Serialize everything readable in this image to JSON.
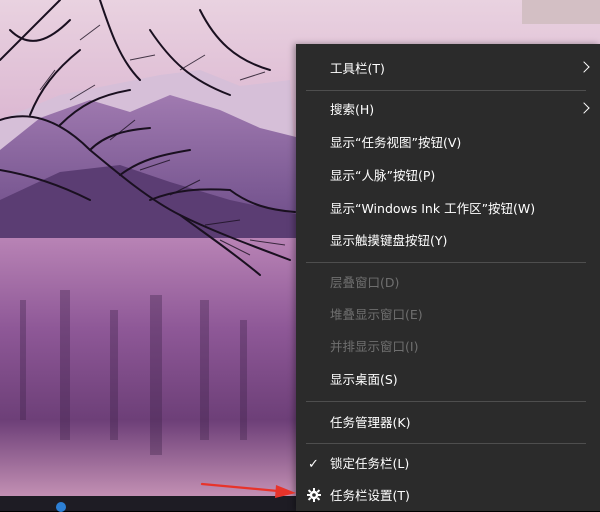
{
  "context_menu": {
    "items": [
      {
        "label": "工具栏(T)",
        "has_submenu": true,
        "enabled": true
      },
      {
        "label": "搜索(H)",
        "has_submenu": true,
        "enabled": true
      },
      {
        "label": "显示“任务视图”按钮(V)",
        "enabled": true
      },
      {
        "label": "显示“人脉”按钮(P)",
        "enabled": true
      },
      {
        "label": "显示“Windows Ink 工作区”按钮(W)",
        "enabled": true
      },
      {
        "label": "显示触摸键盘按钮(Y)",
        "enabled": true
      },
      {
        "label": "层叠窗口(D)",
        "enabled": false
      },
      {
        "label": "堆叠显示窗口(E)",
        "enabled": false
      },
      {
        "label": "并排显示窗口(I)",
        "enabled": false
      },
      {
        "label": "显示桌面(S)",
        "enabled": true
      },
      {
        "label": "任务管理器(K)",
        "enabled": true
      },
      {
        "label": "锁定任务栏(L)",
        "enabled": true,
        "checked": true,
        "icon": "checkmark-icon"
      },
      {
        "label": "任务栏设置(T)",
        "enabled": true,
        "icon": "gear-icon"
      }
    ]
  },
  "annotation": {
    "arrow_color": "#e8332a",
    "points_to": "任务栏设置(T)"
  },
  "colors": {
    "menu_bg": "#2b2b2b",
    "menu_text": "#ffffff",
    "disabled_text": "#6f6f6f",
    "separator": "#4e4e4e"
  }
}
